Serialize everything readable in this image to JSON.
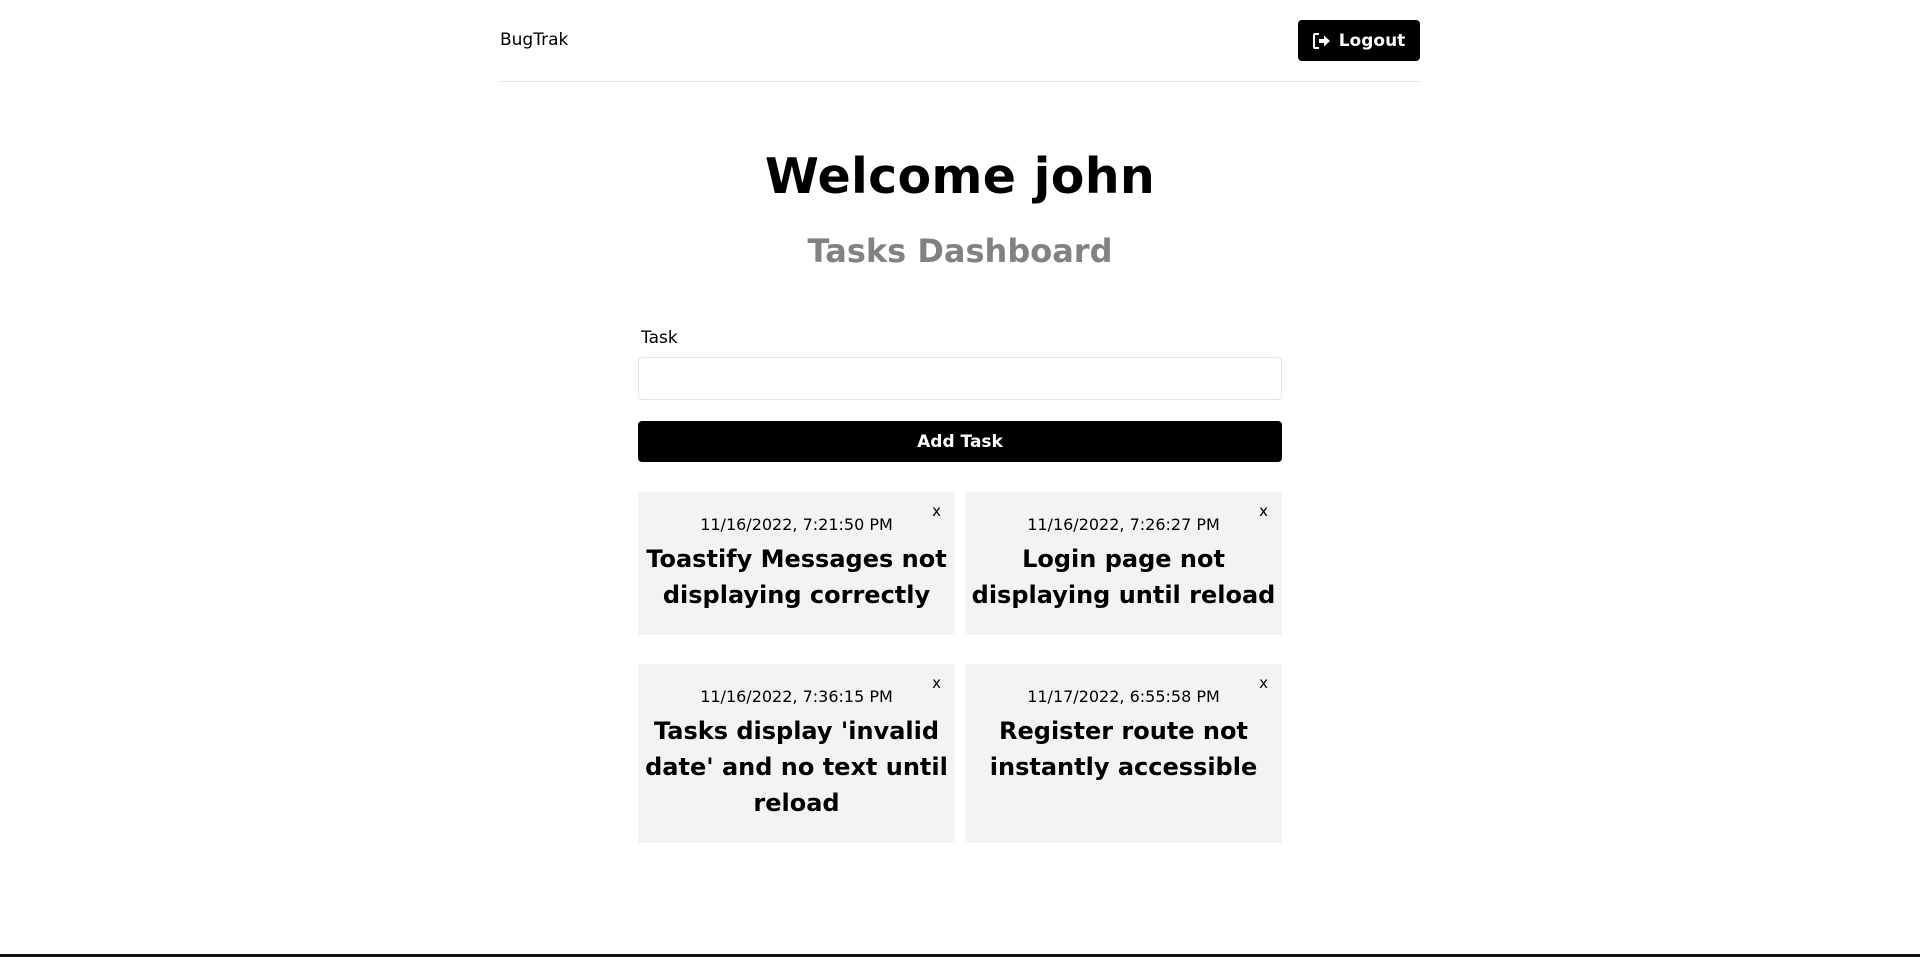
{
  "header": {
    "brand": "BugTrak",
    "logout_label": "Logout",
    "logout_icon": "sign-out-icon"
  },
  "main": {
    "welcome": "Welcome john",
    "subtitle": "Tasks Dashboard"
  },
  "form": {
    "task_label": "Task",
    "task_value": "",
    "task_placeholder": "",
    "add_button_label": "Add Task"
  },
  "tasks": [
    {
      "date": "11/16/2022, 7:21:50 PM",
      "text": "Toastify Messages not displaying correctly",
      "close": "x"
    },
    {
      "date": "11/16/2022, 7:26:27 PM",
      "text": "Login page not displaying until reload",
      "close": "x"
    },
    {
      "date": "11/16/2022, 7:36:15 PM",
      "text": "Tasks display 'invalid date' and no text until reload",
      "close": "x"
    },
    {
      "date": "11/17/2022, 6:55:58 PM",
      "text": "Register route not instantly accessible",
      "close": "x"
    }
  ],
  "colors": {
    "primary": "#000000",
    "card_background": "#f3f3f3",
    "subtitle": "#828282",
    "border": "#e6e6e6"
  }
}
